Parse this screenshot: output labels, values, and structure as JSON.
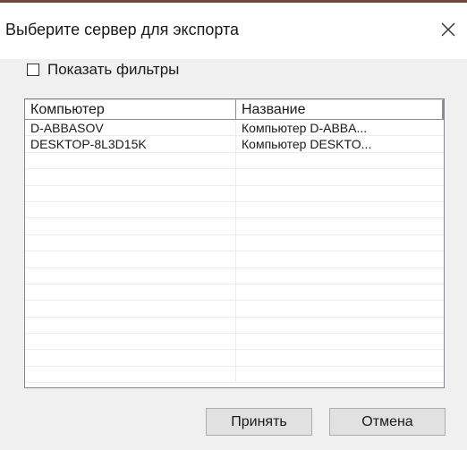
{
  "dialog": {
    "title": "Выберите сервер для экспорта",
    "close_icon": "close-icon"
  },
  "filters": {
    "checkbox_label": "Показать фильтры",
    "checked": false
  },
  "list": {
    "columns": [
      "Компьютер",
      "Название"
    ],
    "rows": [
      [
        "D-ABBASOV",
        "Компьютер D-ABBA..."
      ],
      [
        "DESKTOP-8L3D15K",
        "Компьютер DESKTO..."
      ],
      [
        "",
        ""
      ],
      [
        "",
        ""
      ],
      [
        "",
        ""
      ],
      [
        "",
        ""
      ],
      [
        "",
        ""
      ],
      [
        "",
        ""
      ],
      [
        "",
        ""
      ],
      [
        "",
        ""
      ],
      [
        "",
        ""
      ],
      [
        "",
        ""
      ],
      [
        "",
        ""
      ],
      [
        "",
        ""
      ],
      [
        "",
        ""
      ],
      [
        "",
        ""
      ]
    ]
  },
  "buttons": {
    "accept_label": "Принять",
    "cancel_label": "Отмена"
  },
  "colors": {
    "title_accent": "#6b4a3a",
    "dialog_bg": "#f0f0f0",
    "button_bg": "#e1e1e1"
  }
}
